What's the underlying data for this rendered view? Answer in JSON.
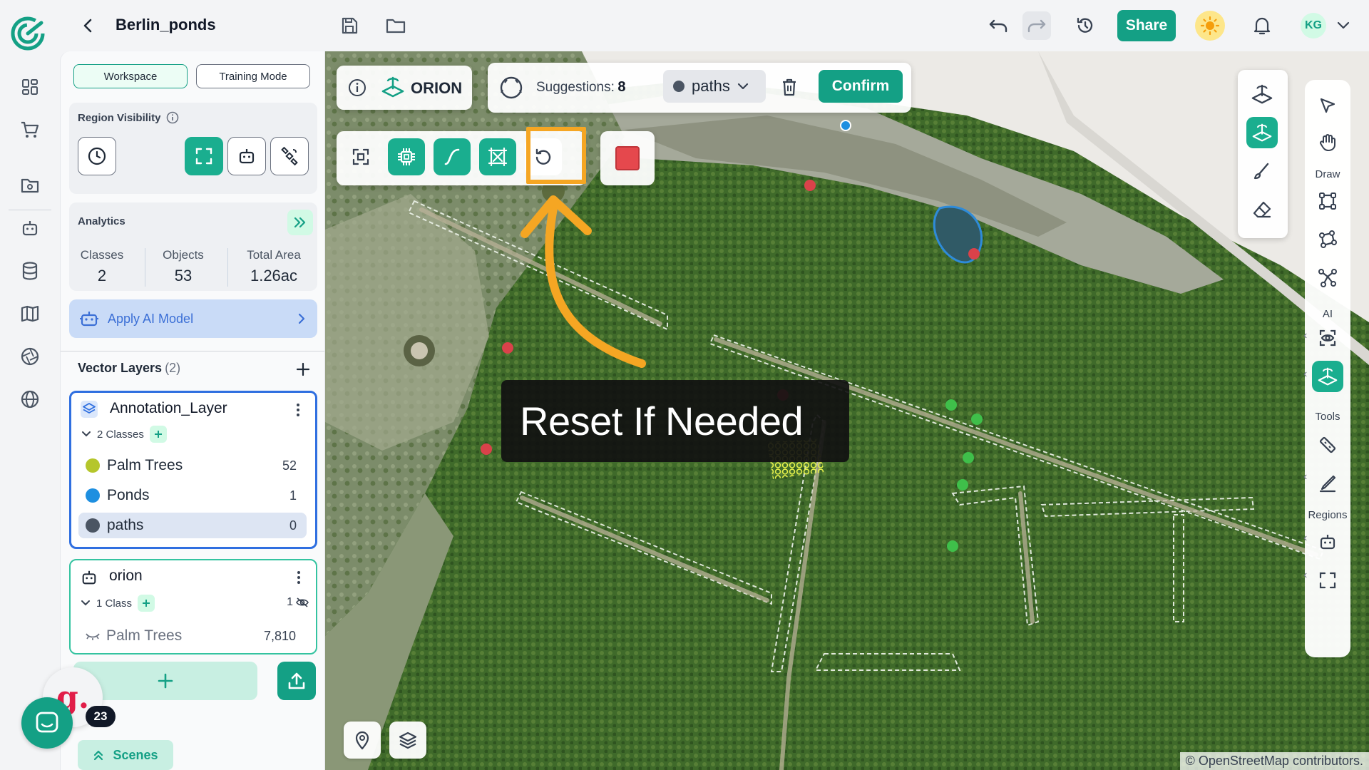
{
  "header": {
    "project_title": "Berlin_ponds",
    "share_label": "Share",
    "user_initials": "KG"
  },
  "panel": {
    "mode_tabs": [
      "Workspace",
      "Training Mode"
    ],
    "active_mode": "Workspace",
    "region_visibility_title": "Region Visibility",
    "analytics": {
      "title": "Analytics",
      "stats": [
        {
          "label": "Classes",
          "value": "2"
        },
        {
          "label": "Objects",
          "value": "53"
        },
        {
          "label": "Total Area",
          "value": "1.26ac"
        }
      ]
    },
    "apply_ai_label": "Apply AI Model",
    "vector_layers_title": "Vector Layers",
    "vector_layers_count": "(2)",
    "layers": [
      {
        "name": "Annotation_Layer",
        "classes_label": "2 Classes",
        "classes": [
          {
            "name": "Palm Trees",
            "count": "52",
            "color": "#b5c62b"
          },
          {
            "name": "Ponds",
            "count": "1",
            "color": "#1e8fe0"
          },
          {
            "name": "paths",
            "count": "0",
            "color": "#4b5563"
          }
        ]
      },
      {
        "name": "orion",
        "classes_label": "1 Class",
        "hidden_count": "1",
        "classes": [
          {
            "name": "Palm Trees",
            "count": "7,810"
          }
        ]
      }
    ],
    "scenes_label": "Scenes",
    "notification_badge": "23",
    "g_logo_letter": "g."
  },
  "map": {
    "orion_label": "ORION",
    "suggestions_label": "Suggestions:",
    "suggestions_value": "8",
    "class_select": "paths",
    "confirm_label": "Confirm",
    "tooltip_text": "Reset If Needed",
    "attribution": "© OpenStreetMap contributors.",
    "right_rail_labels": {
      "draw": "Draw",
      "ai": "AI",
      "tools": "Tools",
      "regions": "Regions"
    }
  },
  "colors": {
    "accent": "#14a085",
    "highlight": "#f5a623",
    "selected_layer_border": "#2f6fe0"
  }
}
